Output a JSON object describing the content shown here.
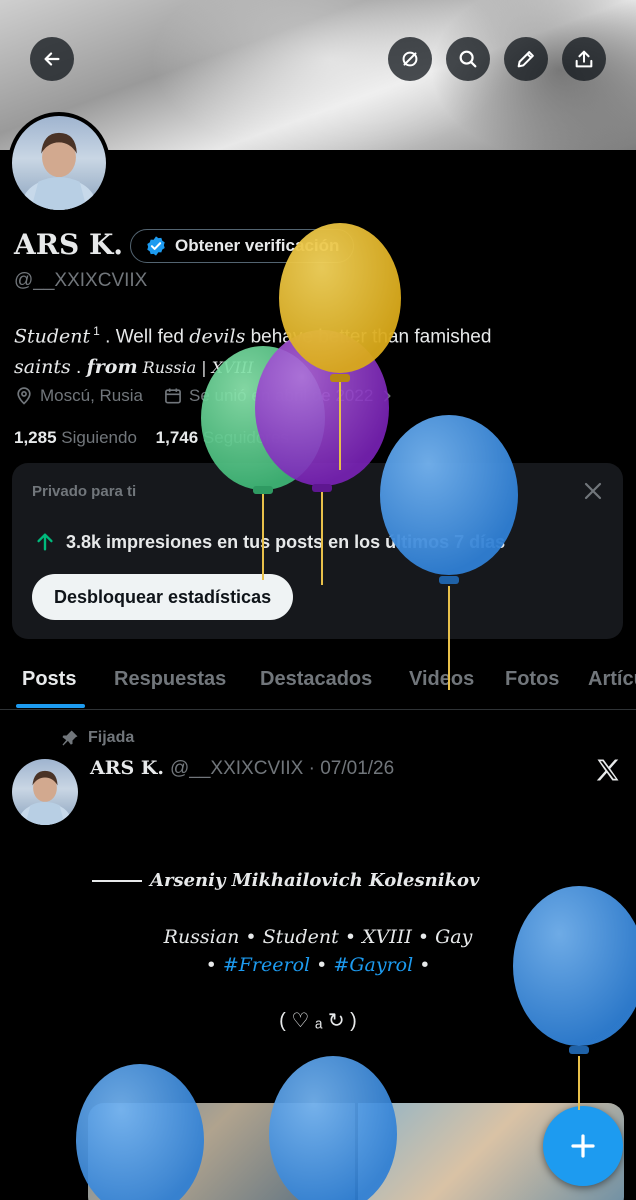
{
  "profile": {
    "name": "ARS K.",
    "verify_label": "Obtener verificación",
    "handle": "@__XXIXCVIIX",
    "bio_word1": "Student",
    "bio_sup": "1",
    "bio_text1": ". Well fed ",
    "bio_word2": "devils",
    "bio_text2": " behave better than famished",
    "bio_word3": "saints",
    "bio_text3": " . ",
    "bio_word4": "from",
    "bio_word5": " Russia | XVIII",
    "location": "Moscú, Rusia",
    "joined": "Se unió en abril de 2022",
    "following_count": "1,285",
    "following_label": "Siguiendo",
    "followers_count": "1,746",
    "followers_label": "Seguidores"
  },
  "card": {
    "title": "Privado para ti",
    "stat_line": "3.8k impresiones en tus posts en los últimos 7 días",
    "button": "Desbloquear estadísticas"
  },
  "tabs": [
    "Posts",
    "Respuestas",
    "Destacados",
    "Videos",
    "Fotos",
    "Artículos"
  ],
  "post": {
    "pinned_label": "Fijada",
    "author": "ARS K.",
    "handle_date": "@__XXIXCVIIX · 07/01/26",
    "line1": "Arseniy Mikhailovich Kolesnikov",
    "line2": "Russian • Student • XVIII • Gay",
    "line3_pre": "• ",
    "tag1": "#Freerol",
    "line3_mid": " • ",
    "tag2": "#Gayrol",
    "line3_post": " •",
    "line4": "( ♡ ₐ ↻ )"
  },
  "icons": {
    "back": "arrow-left-icon",
    "unblock": "slash-circle-icon",
    "search": "search-icon",
    "edit": "pencil-icon",
    "share": "share-icon",
    "verified": "verified-badge-icon",
    "location": "location-pin-icon",
    "calendar": "calendar-icon",
    "chevron": "chevron-right-icon",
    "close": "close-icon",
    "arrow_up": "arrow-up-icon",
    "pin": "pin-icon",
    "x_logo": "x-logo-icon",
    "compose": "plus-icon"
  },
  "colors": {
    "accent": "#1d9bf0",
    "muted": "#71767b",
    "text": "#e7e9ea",
    "green": "#00ba7c"
  }
}
